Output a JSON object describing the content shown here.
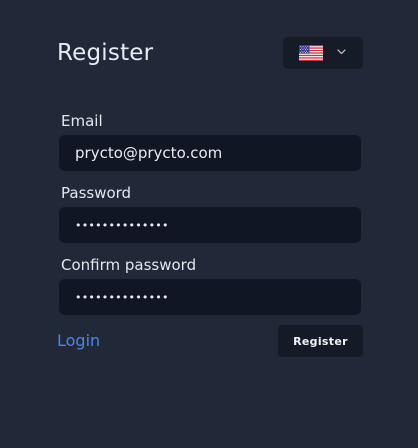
{
  "header": {
    "title": "Register",
    "language": {
      "icon": "us-flag-icon",
      "dropdown_icon": "chevron-down-icon"
    }
  },
  "form": {
    "email": {
      "label": "Email",
      "value": "prycto@prycto.com"
    },
    "password": {
      "label": "Password",
      "value": "••••••••••••••"
    },
    "confirm_password": {
      "label": "Confirm password",
      "value": "••••••••••••••"
    }
  },
  "actions": {
    "login_label": "Login",
    "register_label": "Register"
  },
  "colors": {
    "background": "#212837",
    "input_background": "#101623",
    "link": "#4a86e8",
    "button_background": "#141a26"
  }
}
